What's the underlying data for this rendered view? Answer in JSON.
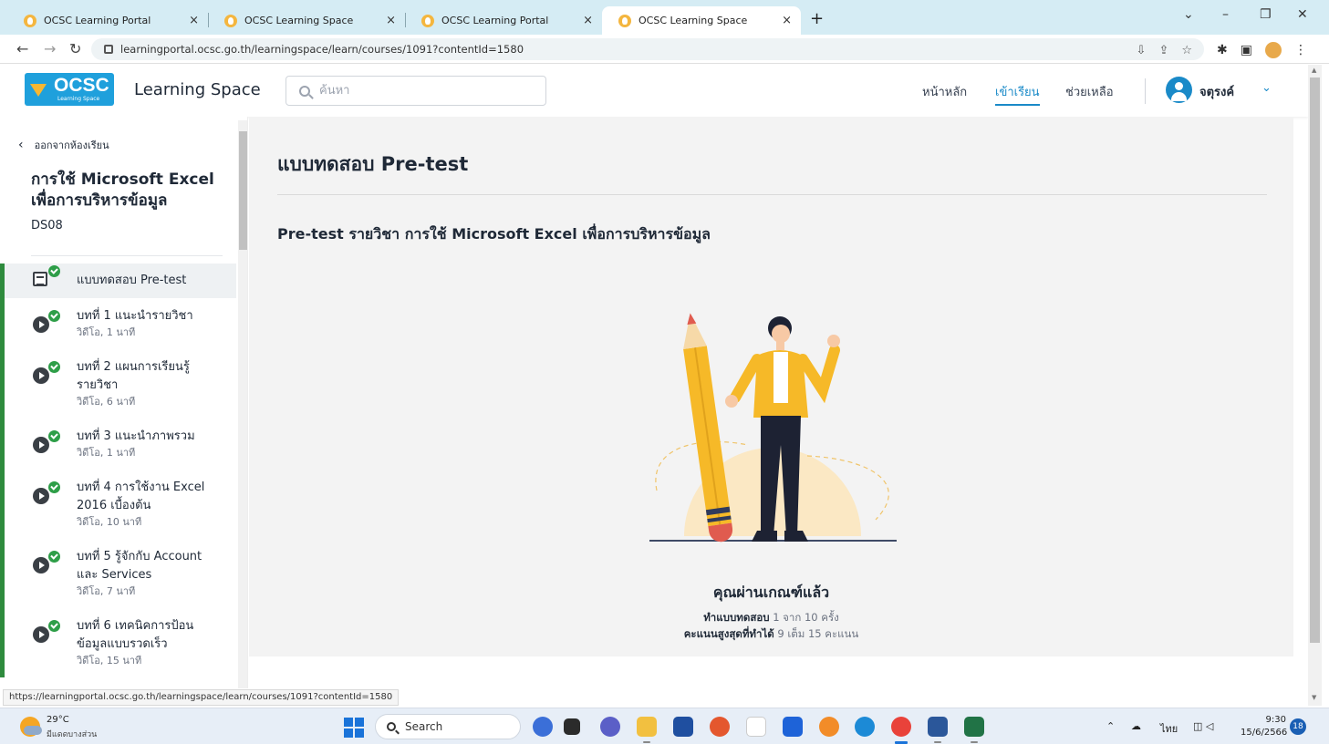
{
  "browser": {
    "tabs": [
      {
        "title": "OCSC Learning Portal",
        "active": false
      },
      {
        "title": "OCSC Learning Space",
        "active": false
      },
      {
        "title": "OCSC Learning Portal",
        "active": false
      },
      {
        "title": "OCSC Learning Space",
        "active": true
      }
    ],
    "close_glyph": "×",
    "new_tab_glyph": "+",
    "url": "learningportal.ocsc.go.th/learningspace/learn/courses/1091?contentId=1580",
    "status_url": "https://learningportal.ocsc.go.th/learningspace/learn/courses/1091?contentId=1580"
  },
  "header": {
    "logo_text": "OCSC",
    "logo_sub": "Learning Space",
    "app_title": "Learning Space",
    "search_placeholder": "ค้นหา",
    "nav": [
      {
        "label": "หน้าหลัก",
        "active": false
      },
      {
        "label": "เข้าเรียน",
        "active": true
      },
      {
        "label": "ช่วยเหลือ",
        "active": false
      }
    ],
    "username": "จตุรงค์"
  },
  "sidebar": {
    "back_label": "ออกจากห้องเรียน",
    "course_title": "การใช้ Microsoft Excel เพื่อการบริหารข้อมูล",
    "course_code": "DS08",
    "lessons": [
      {
        "title": "แบบทดสอบ Pre-test",
        "meta": "",
        "type": "quiz",
        "active": true
      },
      {
        "title": "บทที่ 1 แนะนำรายวิชา",
        "meta": "วิดีโอ, 1 นาที",
        "type": "video",
        "active": false
      },
      {
        "title": "บทที่ 2 แผนการเรียนรู้รายวิชา",
        "meta": "วิดีโอ, 6 นาที",
        "type": "video",
        "active": false
      },
      {
        "title": "บทที่ 3 แนะนำภาพรวม",
        "meta": "วิดีโอ, 1 นาที",
        "type": "video",
        "active": false
      },
      {
        "title": "บทที่ 4 การใช้งาน Excel 2016 เบื้องต้น",
        "meta": "วิดีโอ, 10 นาที",
        "type": "video",
        "active": false
      },
      {
        "title": "บทที่ 5 รู้จักกับ Account และ Services",
        "meta": "วิดีโอ, 7 นาที",
        "type": "video",
        "active": false
      },
      {
        "title": "บทที่ 6 เทคนิคการป้อนข้อมูลแบบรวดเร็ว",
        "meta": "วิดีโอ, 15 นาที",
        "type": "video",
        "active": false
      }
    ]
  },
  "main": {
    "page_title": "แบบทดสอบ Pre-test",
    "quiz_title": "Pre-test รายวิชา การใช้ Microsoft Excel เพื่อการบริหารข้อมูล",
    "result_title": "คุณผ่านเกณฑ์แล้ว",
    "attempts_label": "ทำแบบทดสอบ",
    "attempts_value": "1 จาก 10 ครั้ง",
    "score_label": "คะแนนสูงสุดที่ทำได้",
    "score_value": "9 เต็ม 15 คะแนน"
  },
  "taskbar": {
    "temperature": "29°C",
    "weather": "มีแดดบางส่วน",
    "search_label": "Search",
    "language": "ไทย",
    "time": "9:30",
    "date": "15/6/2566",
    "notifications": "18"
  },
  "colors": {
    "accent": "#1a8ac8",
    "complete": "#2e9e48",
    "lesson_bar": "#2e8b3d"
  }
}
